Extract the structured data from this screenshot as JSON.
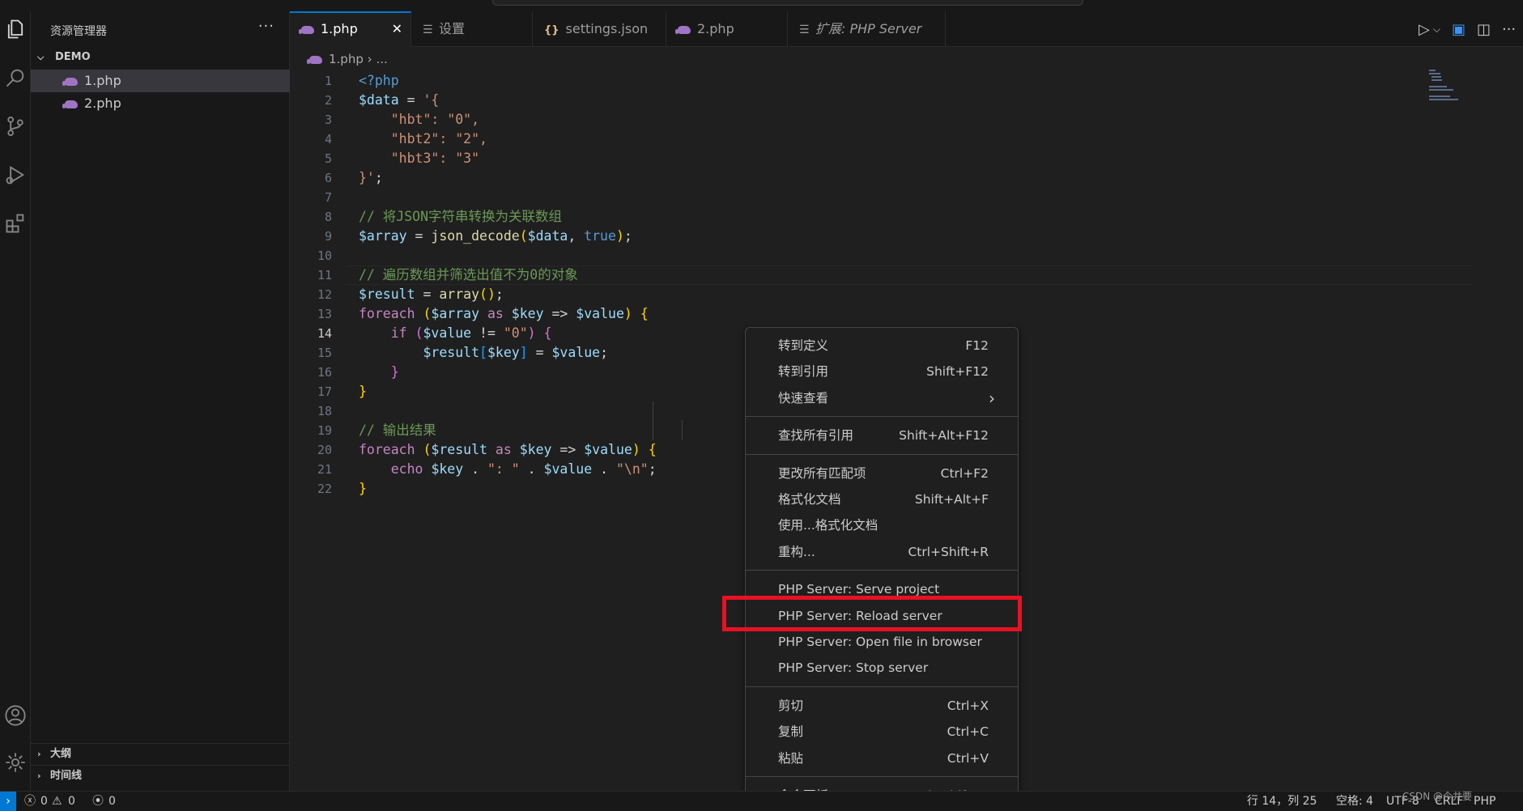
{
  "sidebar": {
    "title": "资源管理器",
    "more": "···",
    "folder": "DEMO",
    "files": [
      "1.php",
      "2.php"
    ],
    "panels": [
      "大纲",
      "时间线"
    ]
  },
  "tabs": [
    {
      "label": "1.php",
      "close": "✕"
    },
    {
      "label": "设置"
    },
    {
      "label": "settings.json"
    },
    {
      "label": "2.php"
    },
    {
      "label": "扩展: PHP Server"
    }
  ],
  "breadcrumb": {
    "file": "1.php",
    "rest": "..."
  },
  "editor": {
    "line_numbers": [
      "1",
      "2",
      "3",
      "4",
      "5",
      "6",
      "7",
      "8",
      "9",
      "10",
      "11",
      "12",
      "13",
      "14",
      "15",
      "16",
      "17",
      "18",
      "19",
      "20",
      "21",
      "22"
    ],
    "current_line": 14
  },
  "context_menu": {
    "groups": [
      [
        {
          "label": "转到定义",
          "key": "F12"
        },
        {
          "label": "转到引用",
          "key": "Shift+F12"
        },
        {
          "label": "快速查看",
          "key": "›"
        }
      ],
      [
        {
          "label": "查找所有引用",
          "key": "Shift+Alt+F12"
        }
      ],
      [
        {
          "label": "更改所有匹配项",
          "key": "Ctrl+F2"
        },
        {
          "label": "格式化文档",
          "key": "Shift+Alt+F"
        },
        {
          "label": "使用...格式化文档",
          "key": ""
        },
        {
          "label": "重构...",
          "key": "Ctrl+Shift+R"
        }
      ],
      [
        {
          "label": "PHP Server: Serve project",
          "key": ""
        },
        {
          "label": "PHP Server: Reload server",
          "key": ""
        },
        {
          "label": "PHP Server: Open file in browser",
          "key": ""
        },
        {
          "label": "PHP Server: Stop server",
          "key": ""
        }
      ],
      [
        {
          "label": "剪切",
          "key": "Ctrl+X"
        },
        {
          "label": "复制",
          "key": "Ctrl+C"
        },
        {
          "label": "粘贴",
          "key": "Ctrl+V"
        }
      ],
      [
        {
          "label": "命令面板...",
          "key": "Ctrl+Shift+P"
        }
      ]
    ],
    "highlighted_item": "PHP Server: Reload server",
    "highlight_color": "#e81123"
  },
  "statusbar": {
    "errors": "0",
    "warnings": "0",
    "ports": "0",
    "position": "行 14，列 25",
    "spaces": "空格: 4",
    "encoding": "UTF-8",
    "eol": "CRLF",
    "language": "PHP",
    "watermark": "CSDN @今井要"
  },
  "colors": {
    "accent": "#0078d4",
    "keyword": "#c586c0",
    "variable": "#9cdcfe",
    "string": "#ce9178",
    "comment": "#6a9955",
    "function": "#dcdcaa"
  }
}
